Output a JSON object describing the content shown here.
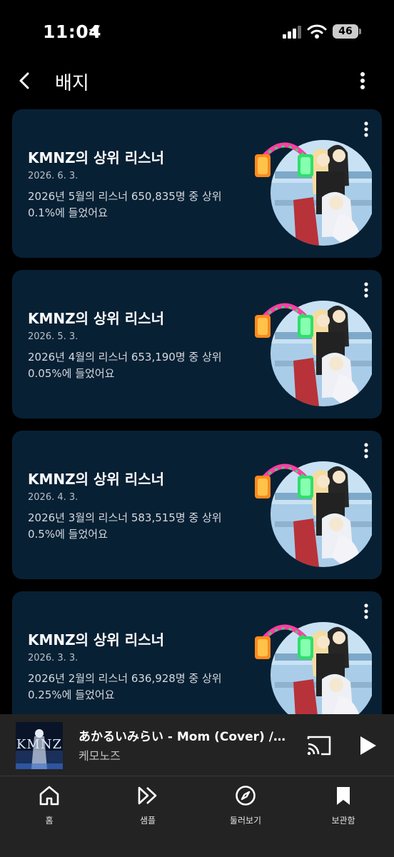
{
  "status_bar": {
    "time": "11:04",
    "battery": "46"
  },
  "header": {
    "title": "배지"
  },
  "badges": [
    {
      "title": "KMNZ의 상위 리스너",
      "date": "2026. 6. 3.",
      "desc": "2026년 5월의 리스너 650,835명 중 상위 0.1%에 들었어요",
      "headphone_color": "#ff3ea5"
    },
    {
      "title": "KMNZ의 상위 리스너",
      "date": "2026. 5. 3.",
      "desc": "2026년 4월의 리스너 653,190명 중 상위 0.05%에 들었어요",
      "headphone_color": "#ff3ea5"
    },
    {
      "title": "KMNZ의 상위 리스너",
      "date": "2026. 4. 3.",
      "desc": "2026년 3월의 리스너 583,515명 중 상위 0.5%에 들었어요",
      "headphone_color": "#ff3ea5"
    },
    {
      "title": "KMNZ의 상위 리스너",
      "date": "2026. 3. 3.",
      "desc": "2026년 2월의 리스너 636,928명 중 상위 0.25%에 들었어요",
      "headphone_color": "#ff3ea5"
    }
  ],
  "player": {
    "album_text": "KMNZ",
    "song_title": "あかるいみらい - Mom (Cover) / KMNZ LITA",
    "artist": "케모노즈"
  },
  "nav": [
    {
      "label": "홈",
      "icon": "home-icon"
    },
    {
      "label": "샘플",
      "icon": "samples-icon"
    },
    {
      "label": "둘러보기",
      "icon": "explore-icon"
    },
    {
      "label": "보관함",
      "icon": "library-icon"
    }
  ],
  "colors": {
    "card_bg": "#082034",
    "bar_bg": "#232323",
    "accent_pink": "#ff3ea5",
    "accent_green": "#2ee06a",
    "accent_orange": "#ff8a1e"
  }
}
